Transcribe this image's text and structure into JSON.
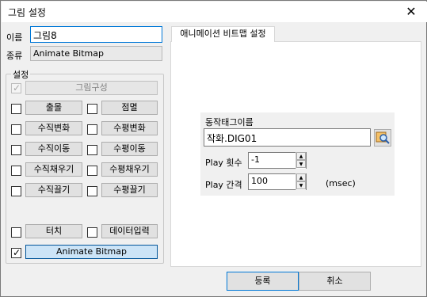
{
  "window": {
    "title": "그림 설정",
    "close_symbol": "✕"
  },
  "name_label": "이름",
  "name_value": "그림8",
  "type_label": "종류",
  "type_value": "Animate Bitmap",
  "settings_group": {
    "caption": "설정",
    "picture_config": "그림구성",
    "blink": "출몰",
    "flash": "점멸",
    "vertical_change": "수직변화",
    "horizontal_change": "수평변화",
    "vertical_move": "수직이동",
    "horizontal_move": "수평이동",
    "vertical_fill": "수직채우기",
    "horizontal_fill": "수평채우기",
    "vertical_drag": "수직끌기",
    "horizontal_drag": "수평끌기",
    "touch": "터치",
    "data_input": "데이터입력",
    "animate_bitmap": "Animate Bitmap",
    "check_mark": "✓"
  },
  "tab": {
    "label": "애니메이션 비트맵 설정"
  },
  "anim": {
    "tag_label": "동작태그이름",
    "tag_value": "작화.DIG01",
    "play_count_label": "Play 횟수",
    "play_count_value": "-1",
    "play_interval_label": "Play 간격",
    "play_interval_value": "100",
    "unit_label": "(msec)",
    "spin_up": "▲",
    "spin_down": "▼"
  },
  "buttons": {
    "ok": "등록",
    "cancel": "취소"
  }
}
